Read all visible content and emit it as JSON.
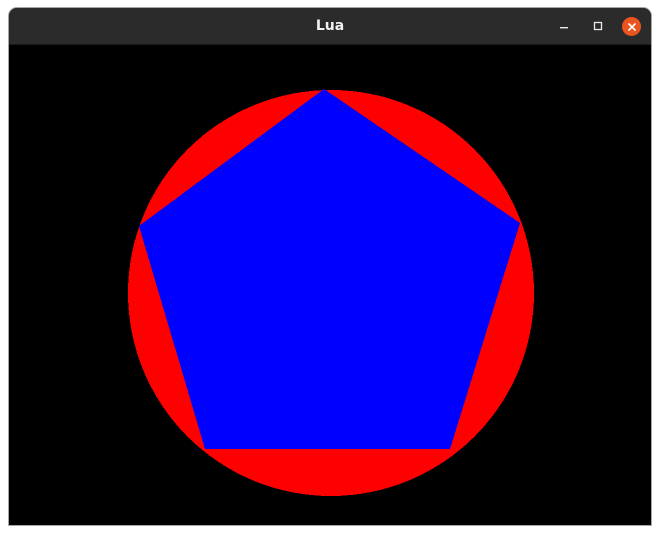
{
  "window": {
    "title": "Lua",
    "controls": {
      "minimize_icon": "minimize-icon",
      "maximize_icon": "maximize-icon",
      "close_icon": "close-icon"
    }
  },
  "scene": {
    "background_color": "#000000",
    "circle": {
      "color": "#ff0000"
    },
    "pentagon": {
      "color": "#0000ff"
    }
  }
}
